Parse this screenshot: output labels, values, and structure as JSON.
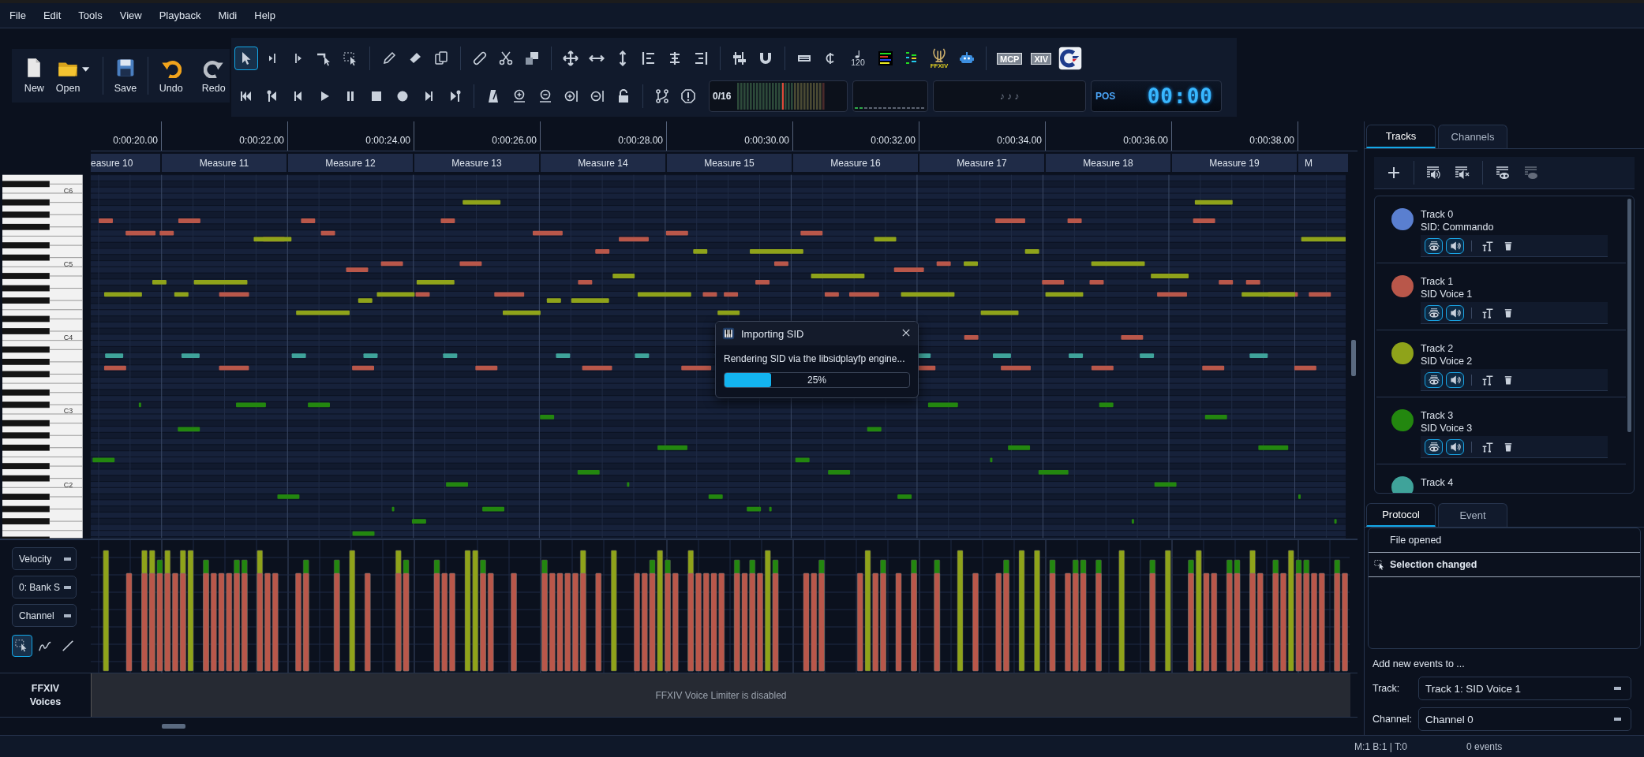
{
  "menu": [
    "File",
    "Edit",
    "Tools",
    "View",
    "Playback",
    "Midi",
    "Help"
  ],
  "file_buttons": [
    {
      "label": "New"
    },
    {
      "label": "Open"
    },
    {
      "label": "Save"
    },
    {
      "label": "Undo"
    },
    {
      "label": "Redo"
    }
  ],
  "edit_tools": [
    {
      "selected": true
    },
    {
      "selected": false
    },
    {
      "selected": false
    },
    {
      "selected": false
    },
    {
      "selected": false
    }
  ],
  "toolbar_badges": {
    "tempo": "120",
    "ffxiv": "FFXIV",
    "mcp": "MCP",
    "xiv": "XIV"
  },
  "meter": {
    "count": "0/16"
  },
  "lyrics_display": "♪ ♪ ♪",
  "position": {
    "label": "POS",
    "time": "00:00"
  },
  "timeline": {
    "times": [
      "0:00:20.00",
      "0:00:22.00",
      "0:00:24.00",
      "0:00:26.00",
      "0:00:28.00",
      "0:00:30.00",
      "0:00:32.00",
      "0:00:34.00",
      "0:00:36.00",
      "0:00:38.00"
    ],
    "measures": [
      "easure 10",
      "Measure 11",
      "Measure 12",
      "Measure 13",
      "Measure 14",
      "Measure 15",
      "Measure 16",
      "Measure 17",
      "Measure 18",
      "Measure 19",
      "M"
    ]
  },
  "keyboard": {
    "labels": [
      "C6",
      "C5",
      "C4",
      "C3",
      "C2"
    ]
  },
  "dialog": {
    "title": "Importing SID",
    "message": "Rendering SID via the libsidplayfp engine...",
    "level": 0.25,
    "reading": "25%"
  },
  "velocity_panel": {
    "selectors": [
      "Velocity",
      "0: Bank S",
      "Channel"
    ],
    "modes": [
      {
        "selected": true
      },
      {
        "selected": false
      },
      {
        "selected": false
      }
    ]
  },
  "voices_panel": {
    "title": "FFXIV Voices",
    "message": "FFXIV Voice Limiter is disabled"
  },
  "status_bar": {
    "position": "M:1 B:1 | T:0",
    "events": "0 events"
  },
  "track_tabs": [
    {
      "label": "Tracks",
      "selected": true
    },
    {
      "label": "Channels",
      "selected": false
    }
  ],
  "tracks": [
    {
      "name": "Track 0",
      "subtitle": "SID: Commando",
      "color": "#5a7fd0",
      "visible": true,
      "audible": true
    },
    {
      "name": "Track 1",
      "subtitle": "SID Voice 1",
      "color": "#b9574a",
      "visible": true,
      "audible": true
    },
    {
      "name": "Track 2",
      "subtitle": "SID Voice 2",
      "color": "#8fa31a",
      "visible": true,
      "audible": true
    },
    {
      "name": "Track 3",
      "subtitle": "SID Voice 3",
      "color": "#23870f",
      "visible": true,
      "audible": true
    },
    {
      "name": "Track 4",
      "color": "#3fa39a"
    }
  ],
  "lower_tabs": [
    {
      "label": "Protocol",
      "selected": true
    },
    {
      "label": "Event",
      "selected": false
    }
  ],
  "protocol": [
    {
      "text": "File opened",
      "selected": false
    },
    {
      "text": "Selection changed",
      "selected": true
    }
  ],
  "add_events": {
    "heading": "Add new events to ...",
    "track_label": "Track:",
    "track_value": "Track 1: SID Voice 1",
    "channel_label": "Channel:",
    "channel_value": "Channel 0"
  }
}
